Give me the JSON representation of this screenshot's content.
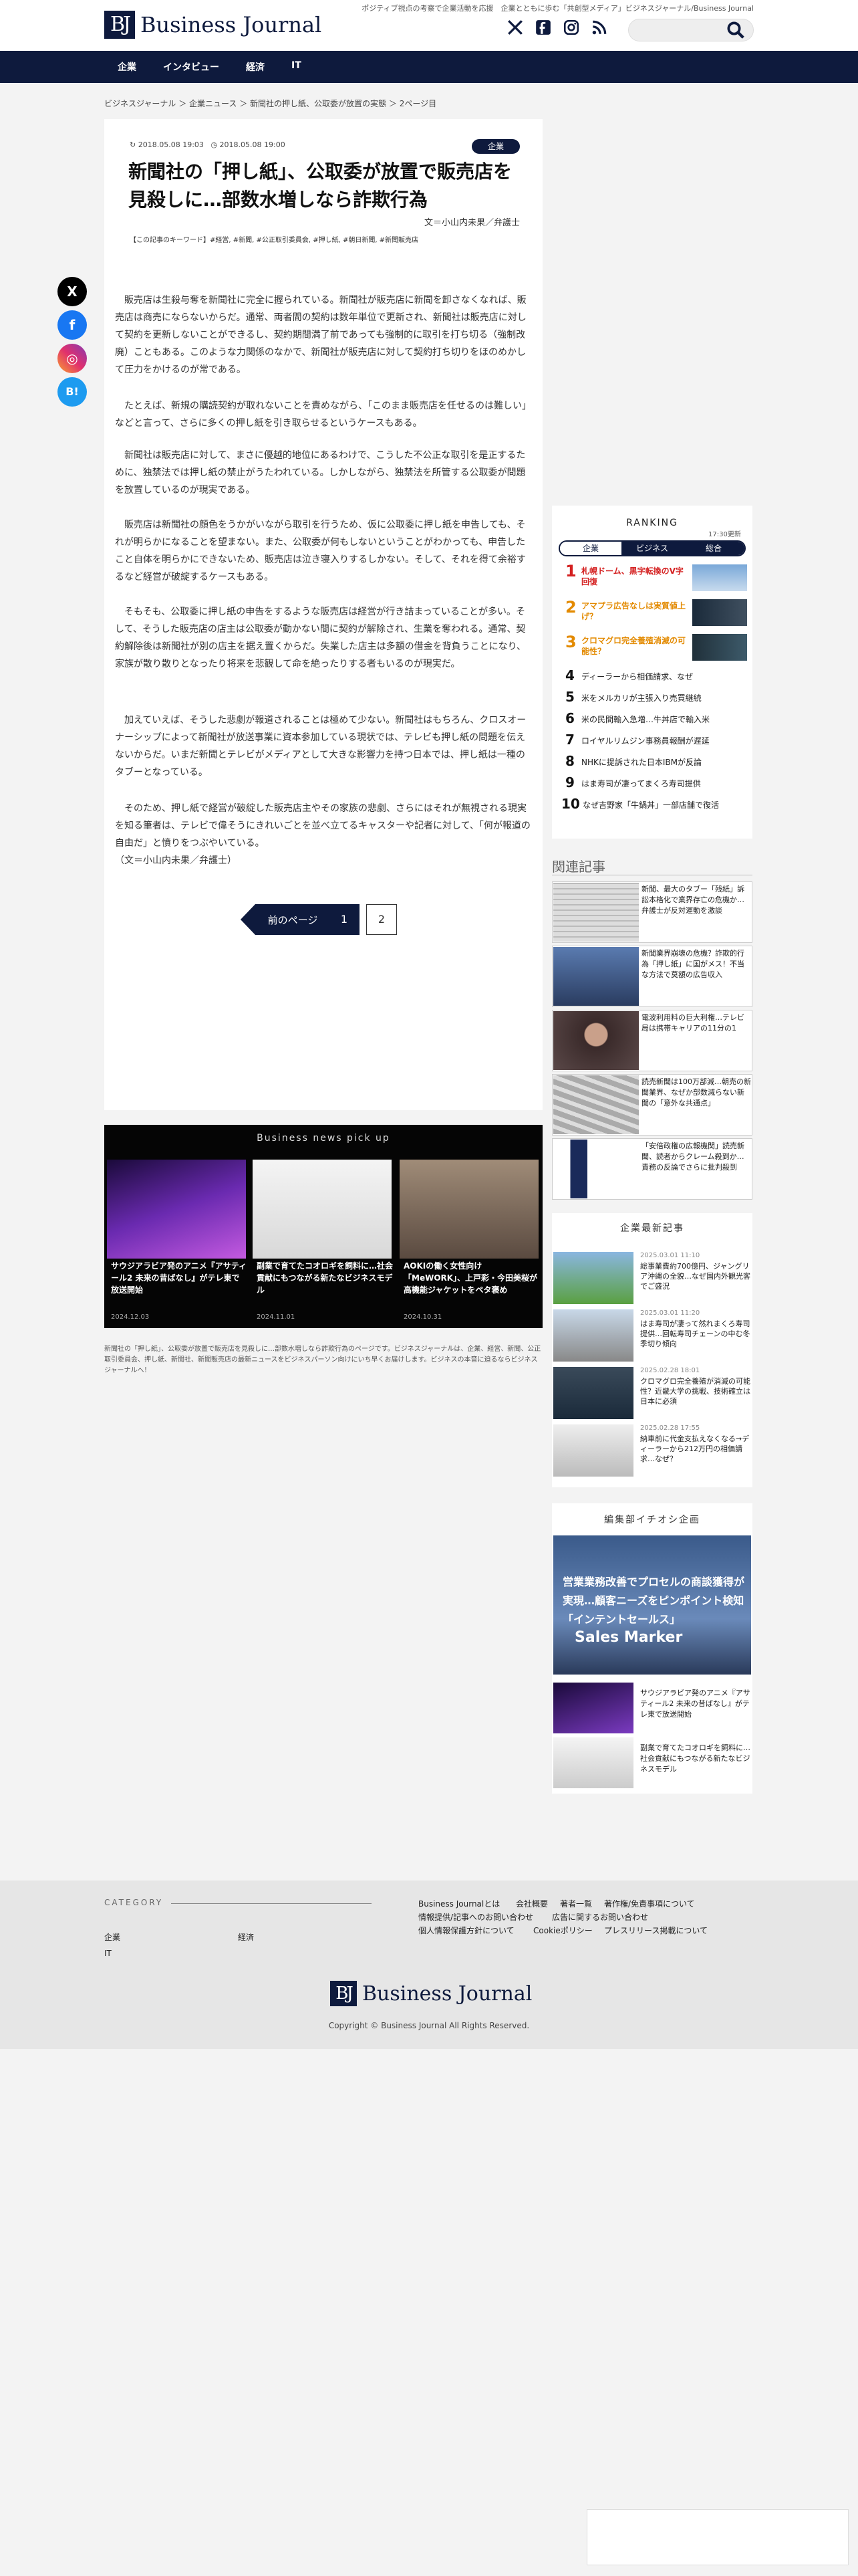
{
  "header": {
    "tagline": "ポジティブ視点の考察で企業活動を応援　企業とともに歩む「共創型メディア」ビジネスジャーナル/Business Journal",
    "logo_mark": "BJ",
    "logo_text": "Business Journal",
    "search_placeholder": ""
  },
  "nav": [
    "企業",
    "インタビュー",
    "経済",
    "IT"
  ],
  "breadcrumb": "ビジネスジャーナル ＞ 企業ニュース ＞ 新聞社の押し紙、公取委が放置の実態 ＞ 2ページ目",
  "article": {
    "updated": "2018.05.08 19:03",
    "published": "2018.05.08 19:00",
    "category": "企業",
    "title": "新聞社の「押し紙」、公取委が放置で販売店を見殺しに…部数水増しなら詐欺行為",
    "author": "文＝小山内未果／弁護士",
    "keywords": "【この記事のキーワード】#経営, #新聞, #公正取引委員会, #押し紙, #朝日新聞, #新聞販売店",
    "paragraphs": [
      "販売店は生殺与奪を新聞社に完全に握られている。新聞社が販売店に新聞を卸さなくなれば、販売店は商売にならないからだ。通常、両者間の契約は数年単位で更新され、新聞社は販売店に対して契約を更新しないことができるし、契約期間満了前であっても強制的に取引を打ち切る（強制改廃）こともある。このような力関係のなかで、新聞社が販売店に対して契約打ち切りをほのめかして圧力をかけるのが常である。",
      "たとえば、新規の購読契約が取れないことを責めながら、「このまま販売店を任せるのは難しい」などと言って、さらに多くの押し紙を引き取らせるというケースもある。",
      "新聞社は販売店に対して、まさに優越的地位にあるわけで、こうした不公正な取引を是正するために、独禁法では押し紙の禁止がうたわれている。しかしながら、独禁法を所管する公取委が問題を放置しているのが現実である。",
      "販売店は新聞社の顔色をうかがいながら取引を行うため、仮に公取委に押し紙を申告しても、それが明らかになることを望まない。また、公取委が何もしないということがわかっても、申告したこと自体を明らかにできないため、販売店は泣き寝入りするしかない。そして、それを得て余裕するなど経営が破綻するケースもある。",
      "そもそも、公取委に押し紙の申告をするような販売店は経営が行き詰まっていることが多い。そして、そうした販売店の店主は公取委が動かない間に契約が解除され、生業を奪われる。通常、契約解除後は新聞社が別の店主を据え置くからだ。失業した店主は多額の借金を背負うことになり、家族が散り散りとなったり将来を悲観して命を絶ったりする者もいるのが現実だ。",
      "加えていえば、そうした悲劇が報道されることは極めて少ない。新聞社はもちろん、クロスオーナーシップによって新聞社が放送事業に資本参加している現状では、テレビも押し紙の問題を伝えないからだ。いまだ新聞とテレビがメディアとして大きな影響力を持つ日本では、押し紙は一種のタブーとなっている。",
      "そのため、押し紙で経営が破綻した販売店主やその家族の悲劇、さらにはそれが無視される現実を知る筆者は、テレビで偉そうにきれいごとを並べ立てるキャスターや記者に対して、「何が報道の自由だ」と憤りをつぶやいている。",
      "（文＝小山内未果／弁護士）"
    ],
    "prev_label": "前のページ",
    "page1": "1",
    "page2": "2"
  },
  "share": [
    "X",
    "f",
    "◎",
    "B!"
  ],
  "pickup": {
    "title": "Business news pick up",
    "items": [
      {
        "title": "サウジアラビア発のアニメ『アサティール2 未来の昔ばなし』がテレ東で放送開始",
        "date": "2024.12.03"
      },
      {
        "title": "副業で育てたコオロギを飼料に…社会貢献にもつながる新たなビジネスモデル",
        "date": "2024.11.01"
      },
      {
        "title": "AOKIの働く女性向け「MeWORK」、上戸彩・今田美桜が高機能ジャケットをペタ褒め",
        "date": "2024.10.31"
      }
    ]
  },
  "description": "新聞社の「押し紙」、公取委が放置で販売店を見殺しに…部数水増しなら詐欺行為のページです。ビジネスジャーナルは、企業、経営、新聞、公正取引委員会、押し紙、新聞社、新聞販売店の最新ニュースをビジネスパーソン向けにいち早くお届けします。ビジネスの本音に迫るならビジネスジャーナルへ！",
  "ranking": {
    "title": "RANKING",
    "updated": "17:30更新",
    "tabs": [
      "企業",
      "ビジネス",
      "総合"
    ],
    "items": [
      {
        "num": "1",
        "text": "札幌ドーム、黒字転換のV字回復"
      },
      {
        "num": "2",
        "text": "アマプラ広告なしは実質値上げ？"
      },
      {
        "num": "3",
        "text": "クロマグロ完全養殖消滅の可能性？"
      },
      {
        "num": "4",
        "text": "ディーラーから相価請求、なぜ"
      },
      {
        "num": "5",
        "text": "米をメルカリが主張入り売買継続"
      },
      {
        "num": "6",
        "text": "米の民間輸入急増…牛丼店で輸入米"
      },
      {
        "num": "7",
        "text": "ロイヤルリムジン事務員報酬が遅延"
      },
      {
        "num": "8",
        "text": "NHKに提訴された日本IBMが反論"
      },
      {
        "num": "9",
        "text": "はま寿司が凄ってまくろ寿司提供"
      },
      {
        "num": "10",
        "text": "なぜ吉野家「牛鍋丼」一部店舗で復活"
      }
    ],
    "colors": {
      "1": "#d42020",
      "2": "#e38a00",
      "3": "#e38a00"
    }
  },
  "related": {
    "title": "関連記事",
    "items": [
      "新聞、最大のタブー「残紙」訴訟本格化で業界存亡の危機か…弁護士が反対運動を激談",
      "新聞業界崩壊の危機？詐欺的行為「押し紙」に国がメス！不当な方法で莫額の広告収入",
      "電波利用料の巨大利権…テレビ局は携帯キャリアの11分の1",
      "読売新聞は100万部減…朝売の新聞業界、なぜか部数減らない新聞の「意外な共通点」",
      "「安倍政権の広報機関」読売新聞、読者からクレーム殺到か…責務の反論でさらに批判殺到"
    ]
  },
  "corp": {
    "title": "企業最新記事",
    "items": [
      {
        "date": "2025.03.01 11:10",
        "text": "総事業費約700億円、ジャングリア沖縄の全貌…なぜ国内外観光客でご盛況"
      },
      {
        "date": "2025.03.01 11:20",
        "text": "はま寿司が凄って然れまくろ寿司提供…回転寿司チェーンの中む冬季切り傾向"
      },
      {
        "date": "2025.02.28 18:01",
        "text": "クロマグロ完全養殖が消滅の可能性？近畿大学の挑戦、技術確立は日本に必須"
      },
      {
        "date": "2025.02.28 17:55",
        "text": "納車前に代金支払えなくなる→ディーラーから212万円の相価請求…なぜ？"
      }
    ]
  },
  "editor": {
    "title": "編集部イチオシ企画",
    "big": "営業業務改善でプロセルの商談獲得が実現…顧客ニーズをピンポイント検知「インテントセールス」",
    "brand": "Sales Marker",
    "items": [
      "サウジアラビア発のアニメ『アサティール2 未来の昔ばなし』がテレ東で放送開始",
      "副業で育てたコオロギを飼料に…社会貢献にもつながる新たなビジネスモデル"
    ]
  },
  "footer": {
    "category_label": "CATEGORY",
    "categories": [
      "企業",
      "経済",
      "IT"
    ],
    "links": [
      [
        "Business Journalとは",
        "会社概要",
        "著者一覧",
        "著作権/免責事項について"
      ],
      [
        "情報提供/記事へのお問い合わせ",
        "広告に関するお問い合わせ"
      ],
      [
        "個人情報保護方針について",
        "Cookieポリシー",
        "プレスリリース掲載について"
      ]
    ],
    "copyright": "Copyright © Business Journal All Rights Reserved."
  }
}
